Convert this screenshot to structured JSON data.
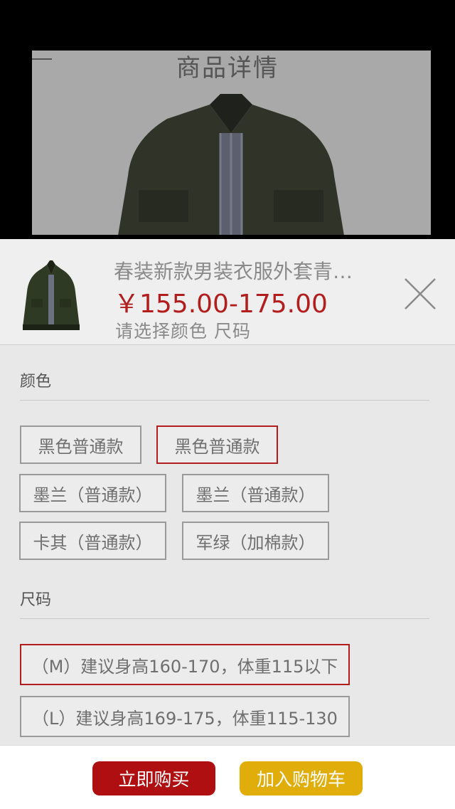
{
  "background_page": {
    "title": "商品详情"
  },
  "product": {
    "title": "春装新款男装衣服外套青…",
    "price": "￥155.00-175.00",
    "hint": "请选择颜色  尺码"
  },
  "color_section": {
    "label": "颜色",
    "options": [
      {
        "label": "黑色普通款",
        "selected": false
      },
      {
        "label": "黑色普通款",
        "selected": true
      },
      {
        "label": "墨兰（普通款）",
        "selected": false
      },
      {
        "label": "墨兰（普通款）",
        "selected": false
      },
      {
        "label": "卡其（普通款）",
        "selected": false
      },
      {
        "label": "军绿（加棉款）",
        "selected": false
      }
    ]
  },
  "size_section": {
    "label": "尺码",
    "options": [
      {
        "label": "（M）建议身高160-170，体重115以下",
        "selected": true
      },
      {
        "label": "（L）建议身高169-175，体重115-130",
        "selected": false
      }
    ]
  },
  "actions": {
    "buy_now": "立即购买",
    "add_to_cart": "加入购物车"
  },
  "colors": {
    "accent_red": "#b31d1d",
    "buy_button": "#b00f12",
    "cart_button": "#e0ad0b"
  }
}
